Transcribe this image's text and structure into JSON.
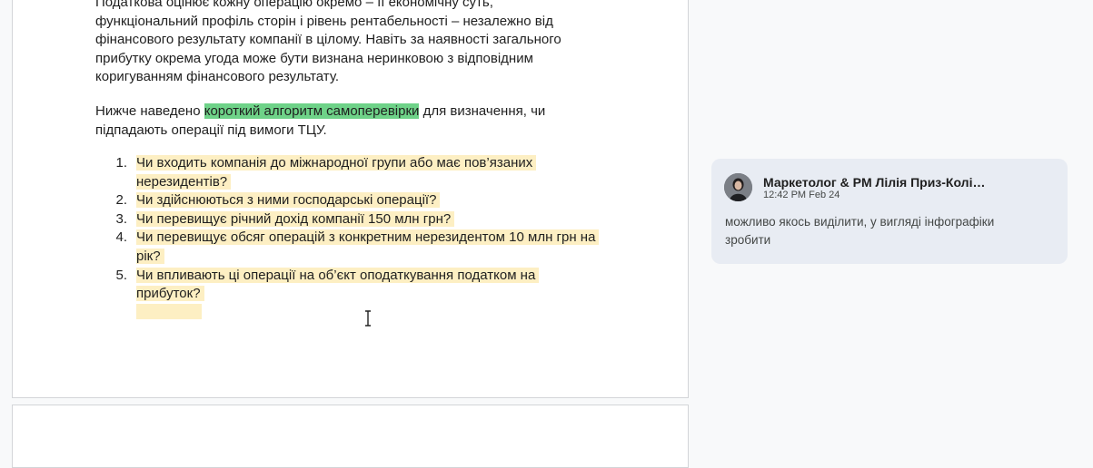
{
  "document": {
    "paragraph1": [
      "Податкова оцінює кожну операцію окремо – її економічну суть,",
      "функціональний профіль сторін і рівень рентабельності – незалежно від",
      "фінансового результату компанії в цілому. Навіть за наявності загального",
      "прибутку окрема угода може бути визнана неринковою з відповідним",
      "коригуванням фінансового результату."
    ],
    "paragraph2": {
      "before": "Нижче наведено ",
      "highlight": "короткий алгоритм самоперевірки",
      "after": " для визначення, чи",
      "line2": "підпадають операції під вимоги ТЦУ."
    },
    "steps": [
      {
        "number": "1.",
        "lines": [
          "Чи входить компанія до міжнародної групи або має пов’язаних",
          "нерезидентів?"
        ]
      },
      {
        "number": "2.",
        "lines": [
          "Чи здійснюються з ними господарські операції?"
        ]
      },
      {
        "number": "3.",
        "lines": [
          "Чи перевищує річний дохід компанії 150 млн грн?"
        ]
      },
      {
        "number": "4.",
        "lines": [
          "Чи перевищує обсяг операцій з конкретним нерезидентом 10 млн грн на",
          "рік?"
        ]
      },
      {
        "number": "5.",
        "lines": [
          "Чи впливають ці операції на об’єкт оподаткування податком на",
          "прибуток?"
        ]
      }
    ]
  },
  "comment": {
    "author": "Маркетолог & PM Лілія Приз-Колісн...",
    "timestamp": "12:42 PM Feb 24",
    "body": "можливо якось виділити, у вигляді інфографіки зробити"
  },
  "colors": {
    "comment_highlight": "#6ed288",
    "suggestion_highlight": "#fdefc3",
    "comment_card": "#e8ecf3"
  },
  "icons": {
    "cursor": "text-cursor-icon",
    "avatar": "user-avatar"
  }
}
